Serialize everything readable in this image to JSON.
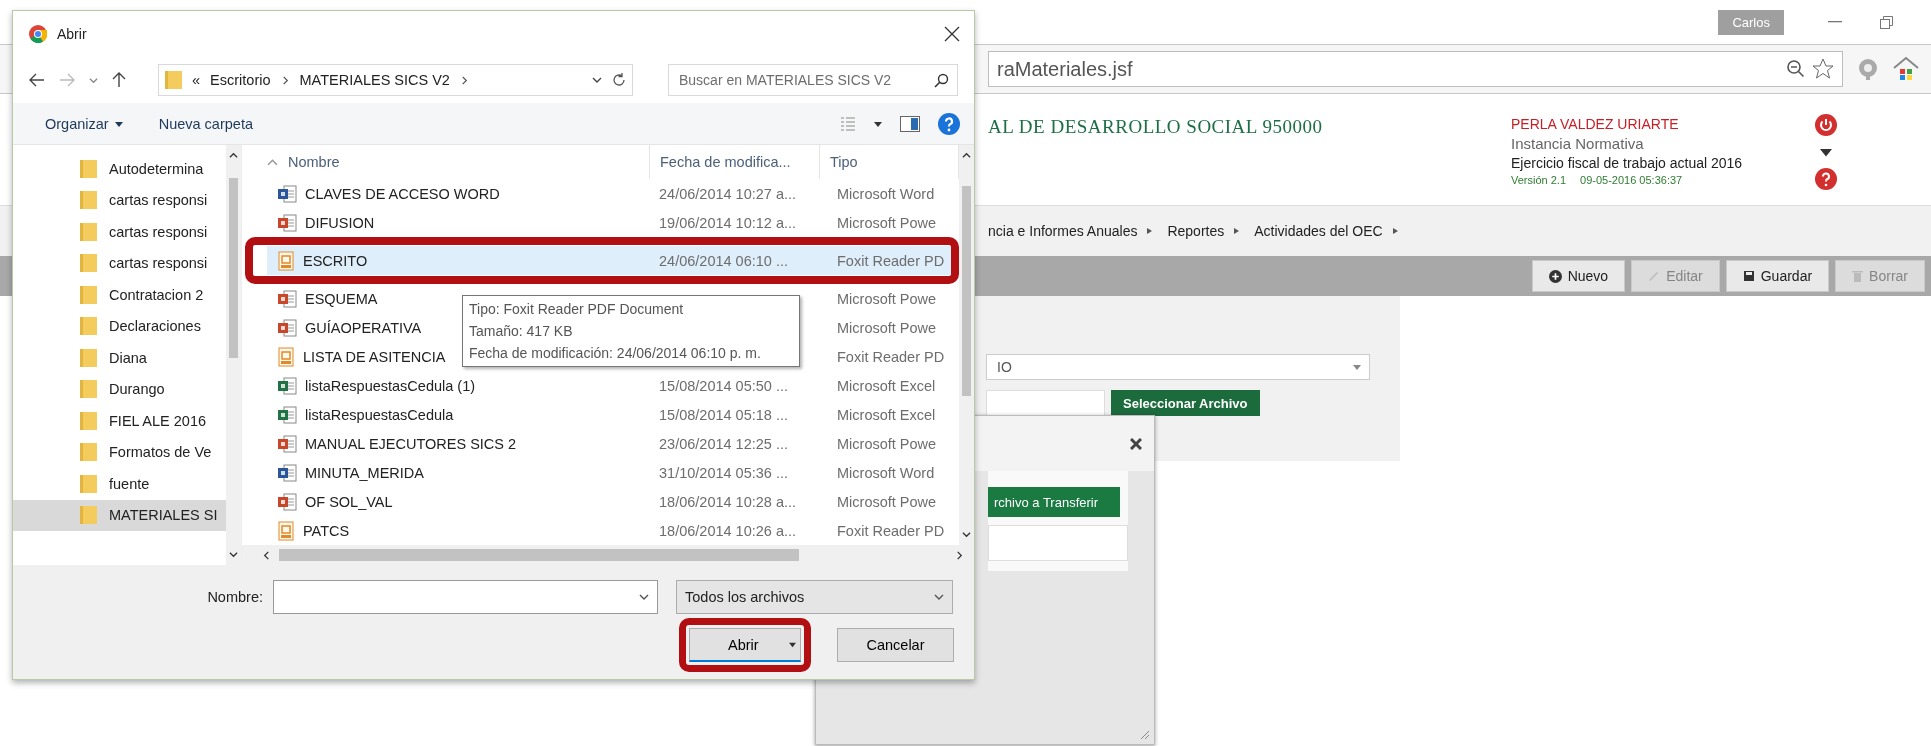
{
  "browser": {
    "profile": "Carlos",
    "address": "raMateriales.jsf"
  },
  "page": {
    "title": "AL DE DESARROLLO SOCIAL 950000",
    "user": "PERLA VALDEZ URIARTE",
    "role": "Instancia Normativa",
    "fiscal_year": "Ejercicio fiscal de trabajo actual  2016",
    "version": "Versión 2.1",
    "timestamp": "09-05-2016 05:36:37",
    "menu": [
      "ncia e Informes Anuales",
      "Reportes",
      "Actividades del OEC"
    ],
    "toolbar": [
      {
        "label": "Nuevo",
        "kind": "new",
        "disabled": false
      },
      {
        "label": "Editar",
        "kind": "edit",
        "disabled": true
      },
      {
        "label": "Guardar",
        "kind": "save",
        "disabled": false
      },
      {
        "label": "Borrar",
        "kind": "delete",
        "disabled": true
      }
    ],
    "form": {
      "select_value": "IO",
      "file_button": "Seleccionar Archivo"
    },
    "modal": {
      "transfer_button": "rchivo a Transferir"
    }
  },
  "dialog": {
    "title": "Abrir",
    "path_overflow": "«",
    "breadcrumb": [
      "Escritorio",
      "MATERIALES SICS V2"
    ],
    "search_placeholder": "Buscar en MATERIALES SICS V2",
    "toolbar": {
      "organize": "Organizar",
      "new_folder": "Nueva carpeta"
    },
    "nav": [
      {
        "label": "Autodetermina",
        "selected": false
      },
      {
        "label": "cartas responsi",
        "selected": false
      },
      {
        "label": "cartas responsi",
        "selected": false
      },
      {
        "label": "cartas responsi",
        "selected": false
      },
      {
        "label": "Contratacion 2",
        "selected": false
      },
      {
        "label": "Declaraciones",
        "selected": false
      },
      {
        "label": "Diana",
        "selected": false
      },
      {
        "label": "Durango",
        "selected": false
      },
      {
        "label": "FIEL ALE 2016",
        "selected": false
      },
      {
        "label": "Formatos de Ve",
        "selected": false
      },
      {
        "label": "fuente",
        "selected": false
      },
      {
        "label": "MATERIALES SI",
        "selected": true
      }
    ],
    "columns": [
      "Nombre",
      "Fecha de modifica...",
      "Tipo"
    ],
    "files": [
      {
        "name": "CLAVES DE ACCESO WORD",
        "date": "24/06/2014 10:27 a...",
        "type": "Microsoft Word",
        "kind": "word",
        "selected": false
      },
      {
        "name": "DIFUSION",
        "date": "19/06/2014 10:12 a...",
        "type": "Microsoft Powe",
        "kind": "powerpoint",
        "selected": false
      },
      {
        "name": "ESCRITO",
        "date": "24/06/2014 06:10 ...",
        "type": "Foxit Reader PD",
        "kind": "pdf",
        "selected": true
      },
      {
        "name": "ESQUEMA",
        "type": "Microsoft Powe",
        "kind": "powerpoint",
        "selected": false
      },
      {
        "name": "GUÍAOPERATIVA",
        "type": "Microsoft Powe",
        "kind": "powerpoint",
        "selected": false
      },
      {
        "name": "LISTA DE ASITENCIA",
        "type": "Foxit Reader PD",
        "kind": "pdf",
        "selected": false
      },
      {
        "name": "listaRespuestasCedula (1)",
        "date": "15/08/2014 05:50 ...",
        "type": "Microsoft Excel",
        "kind": "excel",
        "selected": false
      },
      {
        "name": "listaRespuestasCedula",
        "date": "15/08/2014 05:18 ...",
        "type": "Microsoft Excel",
        "kind": "excel",
        "selected": false
      },
      {
        "name": "MANUAL EJECUTORES SICS 2",
        "date": "23/06/2014 12:25 ...",
        "type": "Microsoft Powe",
        "kind": "powerpoint",
        "selected": false
      },
      {
        "name": "MINUTA_MERIDA",
        "date": "31/10/2014 05:36 ...",
        "type": "Microsoft Word",
        "kind": "word",
        "selected": false
      },
      {
        "name": "OF SOL_VAL",
        "date": "18/06/2014 10:28 a...",
        "type": "Microsoft Powe",
        "kind": "powerpoint",
        "selected": false
      },
      {
        "name": "PATCS",
        "date": "18/06/2014 10:26 a...",
        "type": "Foxit Reader PD",
        "kind": "pdf",
        "selected": false
      }
    ],
    "tooltip": [
      "Tipo: Foxit Reader PDF Document",
      "Tamaño: 417 KB",
      "Fecha de modificación: 24/06/2014 06:10 p. m."
    ],
    "filename_label": "Nombre:",
    "filter": "Todos los archivos",
    "open_button": "Abrir",
    "cancel_button": "Cancelar"
  }
}
